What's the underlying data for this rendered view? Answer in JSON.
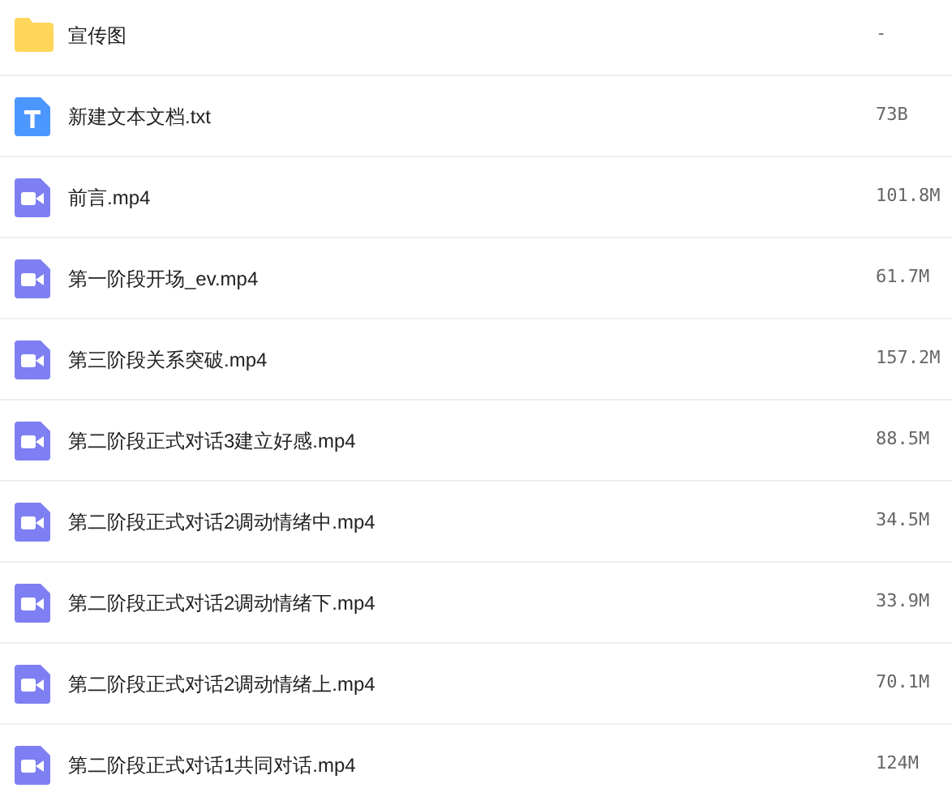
{
  "files": [
    {
      "kind": "folder",
      "name": "宣传图",
      "size": "-"
    },
    {
      "kind": "text",
      "name": "新建文本文档.txt",
      "size": "73B"
    },
    {
      "kind": "video",
      "name": "前言.mp4",
      "size": "101.8M"
    },
    {
      "kind": "video",
      "name": "第一阶段开场_ev.mp4",
      "size": "61.7M"
    },
    {
      "kind": "video",
      "name": "第三阶段关系突破.mp4",
      "size": "157.2M"
    },
    {
      "kind": "video",
      "name": "第二阶段正式对话3建立好感.mp4",
      "size": "88.5M"
    },
    {
      "kind": "video",
      "name": "第二阶段正式对话2调动情绪中.mp4",
      "size": "34.5M"
    },
    {
      "kind": "video",
      "name": "第二阶段正式对话2调动情绪下.mp4",
      "size": "33.9M"
    },
    {
      "kind": "video",
      "name": "第二阶段正式对话2调动情绪上.mp4",
      "size": "70.1M"
    },
    {
      "kind": "video",
      "name": "第二阶段正式对话1共同对话.mp4",
      "size": "124M"
    }
  ]
}
